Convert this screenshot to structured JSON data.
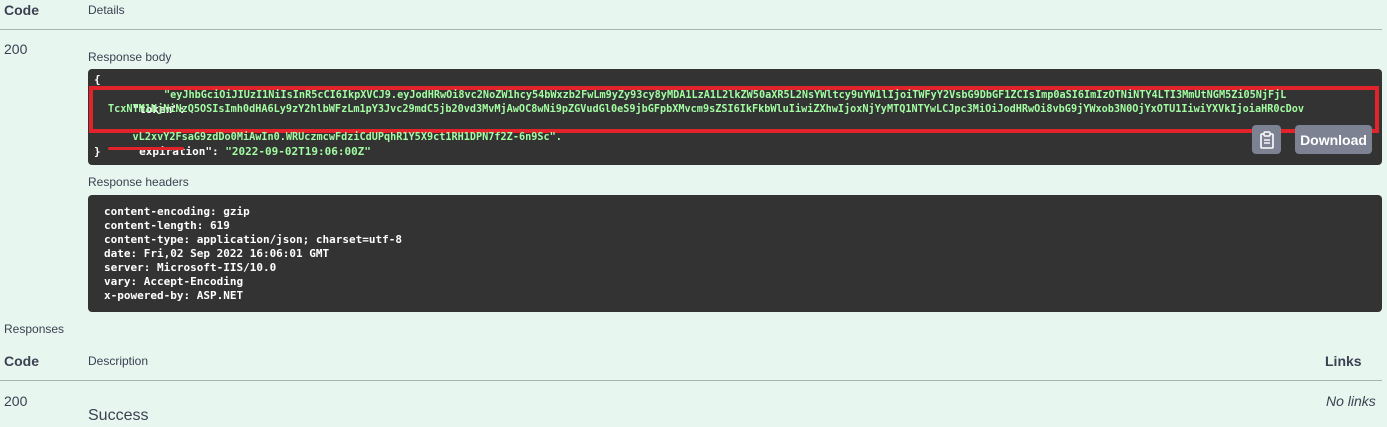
{
  "table": {
    "col_code": "Code",
    "col_details": "Details",
    "row_code": "200"
  },
  "response_body": {
    "label": "Response body",
    "open_brace": "{",
    "close_brace": "}",
    "token_key": "\"token\"",
    "token_value_line1": "\"eyJhbGciOiJIUzI1NiIsInR5cCI6IkpXVCJ9.eyJodHRwOi8vc2NoZW1hcy54bWxzb2FwLm9yZy93cy8yMDA1LzA1L2lkZW50aXR5L2NsYWltcy9uYW1lIjoiTWFyY2VsbG9DbGF1ZCIsImp0aSI6ImIzOTNiNTY4LTI3MmUtNGM5Zi05NjFjL",
    "token_value_line2": "TcxNTM1NjNiNzQ5OSIsImh0dHA6Ly9zY2hlbWFzLm1pY3Jvc29mdC5jb20vd3MvMjAwOC8wNi9pZGVudGl0eS9jbGFpbXMvcm9sZSI6IkFkbWluIiwiZXhwIjoxNjYyMTQ1NTYwLCJpc3MiOiJodHRwOi8vbG9jYWxob3N0OjYxOTU1IiwiYXVkIjoiaHR0cDov",
    "token_value_line3": "vL2xvY2FsaG9zdDo0MiAwIn0.WRUczmcwFdziCdUPqhR1Y5X9ct1RH1DPN7f2Z-6n9Sc\".",
    "expiration_key": "\"expiration\"",
    "expiration_value": "\"2022-09-02T19:06:00Z\"",
    "download_label": "Download",
    "copy_icon": "clipboard-icon"
  },
  "response_headers": {
    "label": "Response headers",
    "lines": [
      "content-encoding: gzip",
      "content-length: 619",
      "content-type: application/json; charset=utf-8",
      "date: Fri,02 Sep 2022 16:06:01 GMT",
      "server: Microsoft-IIS/10.0",
      "vary: Accept-Encoding",
      "x-powered-by: ASP.NET"
    ]
  },
  "responses": {
    "label": "Responses",
    "col_code": "Code",
    "col_description": "Description",
    "col_links": "Links",
    "row_code": "200",
    "row_description": "Success",
    "row_links": "No links"
  },
  "colors": {
    "background": "#e8f6f0",
    "code_bg": "#333333",
    "string_green": "#a2fca2",
    "highlight_red": "#e3232c",
    "button_gray": "#7d8293"
  }
}
